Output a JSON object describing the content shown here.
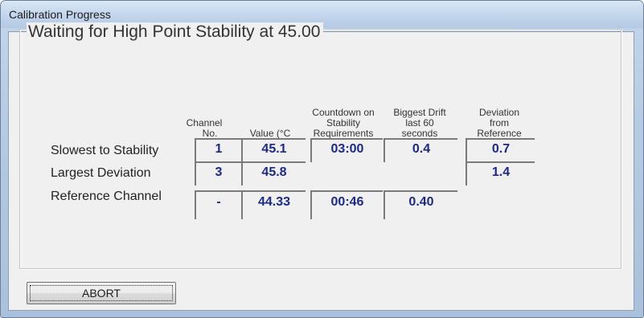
{
  "window": {
    "title": "Calibration Progress"
  },
  "group": {
    "title": "Waiting for High Point Stability at 45.00"
  },
  "headers": {
    "channel": [
      "Channel",
      "No."
    ],
    "value": "Value (°C",
    "countdown": [
      "Countdown on",
      "Stability",
      "Requirements"
    ],
    "drift": [
      "Biggest Drift",
      "last 60",
      "seconds"
    ],
    "deviation": [
      "Deviation",
      "from",
      "Reference"
    ]
  },
  "rows": [
    {
      "label": "Slowest to Stability",
      "channel": "1",
      "value": "45.1",
      "countdown": "03:00",
      "drift": "0.4",
      "deviation": "0.7"
    },
    {
      "label": "Largest Deviation",
      "channel": "3",
      "value": "45.8",
      "countdown": "",
      "drift": "",
      "deviation": "1.4"
    },
    {
      "label": "Reference Channel",
      "channel": "-",
      "value": "44.33",
      "countdown": "00:46",
      "drift": "0.40",
      "deviation": ""
    }
  ],
  "buttons": {
    "abort_label": "ABORT"
  }
}
